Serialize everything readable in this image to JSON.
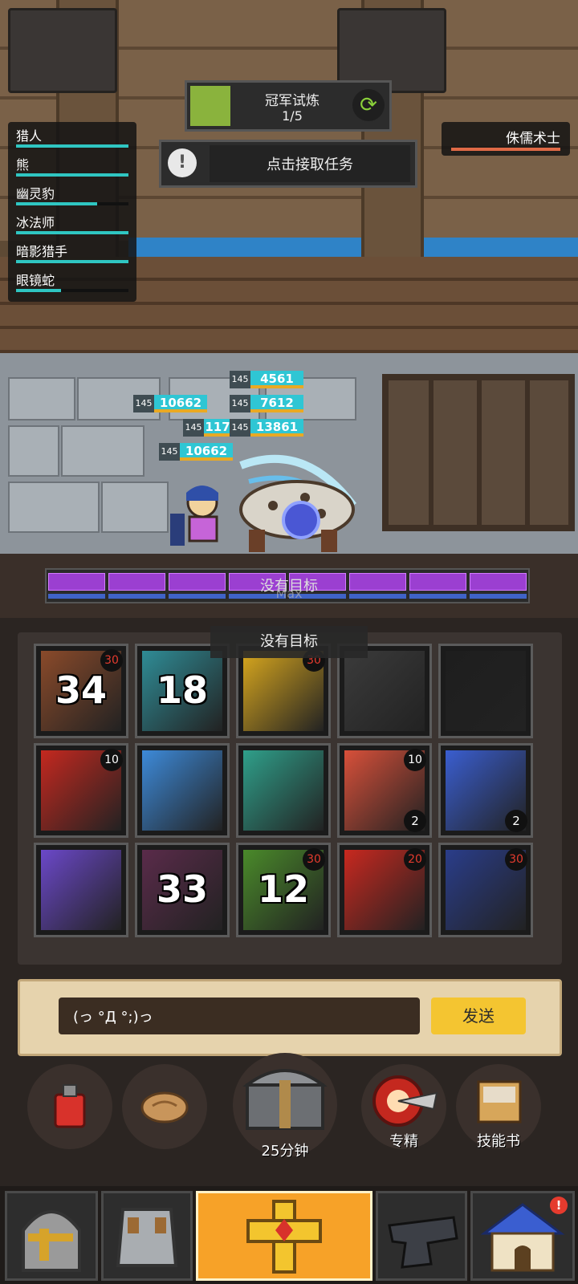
{
  "quest": {
    "trial_title": "冠军试炼",
    "trial_progress": "1/5",
    "accept_label": "点击接取任务"
  },
  "party": [
    {
      "name": "猎人",
      "hp": 1.0
    },
    {
      "name": "熊",
      "hp": 1.0
    },
    {
      "name": "幽灵豹",
      "hp": 0.72
    },
    {
      "name": "冰法师",
      "hp": 1.0
    },
    {
      "name": "暗影猎手",
      "hp": 1.0
    },
    {
      "name": "眼镜蛇",
      "hp": 0.4
    }
  ],
  "enemy": {
    "name": "侏儒术士",
    "hp": 1.0
  },
  "damage_tags": [
    {
      "level": "145",
      "value": "4561"
    },
    {
      "level": "145",
      "value": "10662"
    },
    {
      "level": "145",
      "value": "7612"
    },
    {
      "level": "145",
      "value": "117"
    },
    {
      "level": "145",
      "value": "13861"
    },
    {
      "level": "145",
      "value": "10662"
    }
  ],
  "energy": {
    "segments": 8,
    "max_label": "Max"
  },
  "target_label": "没有目标",
  "target_label_panel": "没有目标",
  "skills": [
    {
      "icon": "bear-claw-icon",
      "number": "34",
      "badge_top": "30",
      "badge_color": "#e33b2e",
      "badge_bottom": ""
    },
    {
      "icon": "tiger-icon",
      "number": "18",
      "badge_top": "",
      "badge_color": "",
      "badge_bottom": ""
    },
    {
      "icon": "armored-fist-icon",
      "number": "",
      "badge_top": "30",
      "badge_color": "#e33b2e",
      "badge_bottom": ""
    },
    {
      "icon": "paw-slash-icon",
      "number": "",
      "badge_top": "",
      "badge_color": "",
      "badge_bottom": ""
    },
    {
      "icon": "sword-icon",
      "number": "",
      "badge_top": "",
      "badge_color": "",
      "badge_bottom": ""
    },
    {
      "icon": "shadow-shield-icon",
      "number": "",
      "badge_top": "10",
      "badge_color": "#ffffff",
      "badge_bottom": ""
    },
    {
      "icon": "ice-wing-icon",
      "number": "",
      "badge_top": "",
      "badge_color": "",
      "badge_bottom": ""
    },
    {
      "icon": "skull-icon",
      "number": "",
      "badge_top": "",
      "badge_color": "",
      "badge_bottom": ""
    },
    {
      "icon": "fire-mouth-icon",
      "number": "",
      "badge_top": "10",
      "badge_color": "#ffffff",
      "badge_bottom": "2"
    },
    {
      "icon": "lightning-icon",
      "number": "",
      "badge_top": "",
      "badge_color": "",
      "badge_bottom": "2"
    },
    {
      "icon": "arrow-volley-icon",
      "number": "",
      "badge_top": "",
      "badge_color": "",
      "badge_bottom": ""
    },
    {
      "icon": "shadow-claw-icon",
      "number": "33",
      "badge_top": "",
      "badge_color": "",
      "badge_bottom": ""
    },
    {
      "icon": "poison-blade-icon",
      "number": "12",
      "badge_top": "30",
      "badge_color": "#e33b2e",
      "badge_bottom": ""
    },
    {
      "icon": "red-strike-icon",
      "number": "",
      "badge_top": "20",
      "badge_color": "#e33b2e",
      "badge_bottom": ""
    },
    {
      "icon": "golden-staff-icon",
      "number": "",
      "badge_top": "30",
      "badge_color": "#e33b2e",
      "badge_bottom": ""
    }
  ],
  "chat": {
    "input_value": "(っ °Д °;)っ",
    "send_label": "发送"
  },
  "actions": {
    "chest_timer": "25分钟",
    "specialization_label": "专精",
    "skillbook_label": "技能书"
  },
  "nav": {
    "tabs": [
      "helmet-icon",
      "armor-icon",
      "talisman-icon",
      "anvil-icon",
      "town-icon"
    ],
    "active_index": 2,
    "alert_label": "!"
  }
}
